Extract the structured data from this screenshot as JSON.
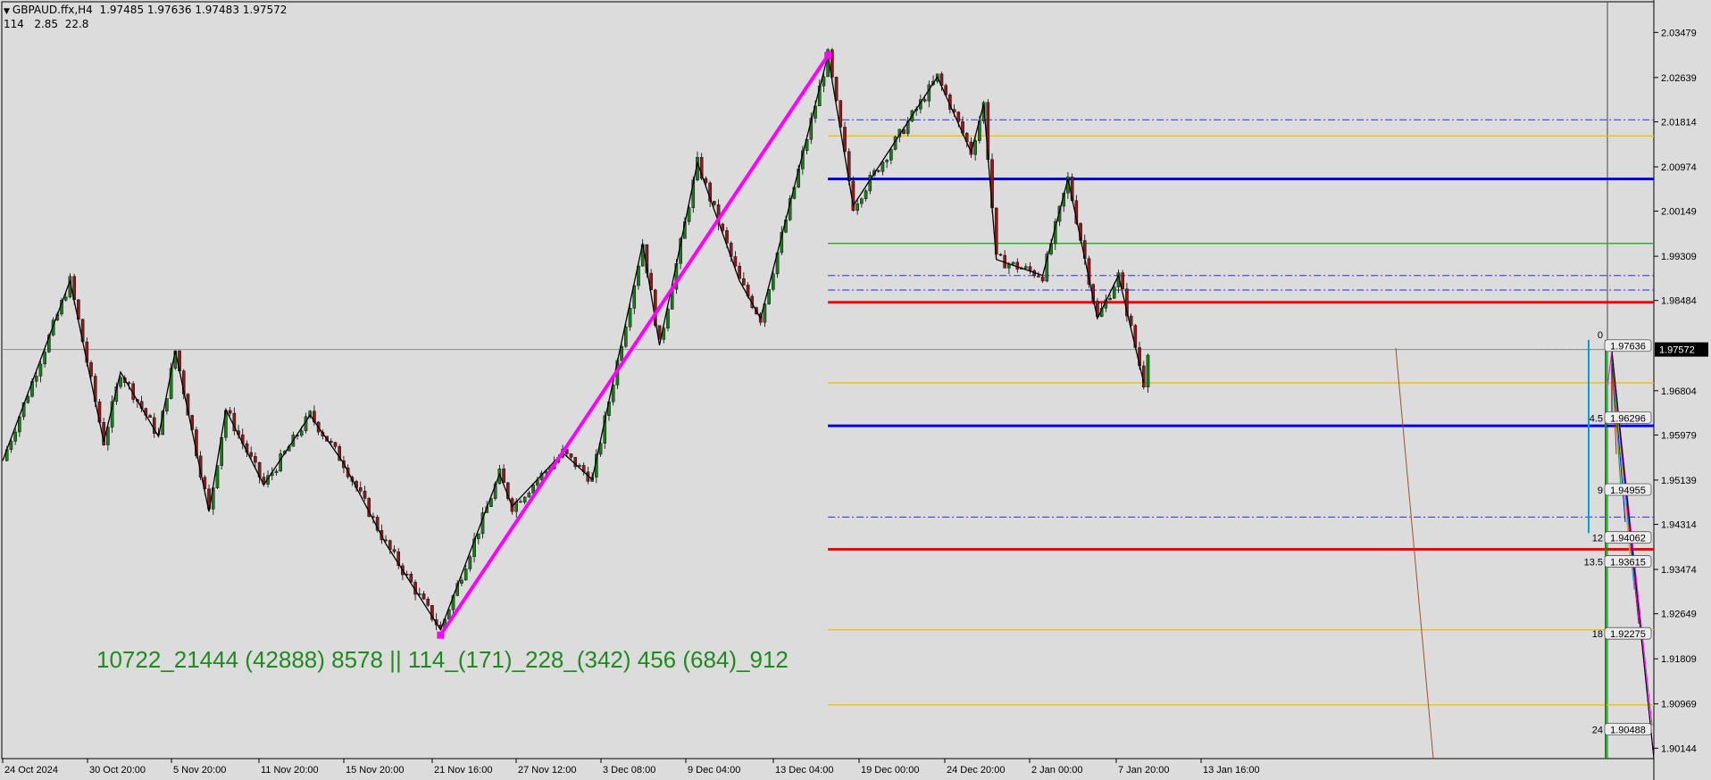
{
  "header": {
    "symbol": "GBPAUD.ffx,H4",
    "ohlc": "1.97485 1.97636 1.97483 1.97572",
    "indicator": "114   2.85  22.8"
  },
  "big_label": "10722_21444 (42888) 8578 || 114_(171)_228_(342) 456 (684)_912",
  "colors": {
    "background": "#dcdcdc",
    "zigzag": "#000000",
    "magenta_line": "#ff00ff",
    "blue": "#0000ee",
    "red": "#ff0000",
    "yellow": "#f2c200",
    "green": "#1fb01f",
    "dashdot": "#2a2ae0",
    "big_label": "#1f8b1f",
    "bull_candle": "#1a7a1a",
    "bear_candle": "#8b1a1a"
  },
  "chart_data": {
    "type": "line",
    "timeframe": "H4",
    "current_price": "1.97572",
    "x_tick_labels": [
      "24 Oct 2024",
      "30 Oct 20:00",
      "5 Nov 20:00",
      "11 Nov 20:00",
      "15 Nov 20:00",
      "21 Nov 16:00",
      "27 Nov 12:00",
      "3 Dec 08:00",
      "9 Dec 04:00",
      "13 Dec 04:00",
      "19 Dec 00:00",
      "24 Dec 20:00",
      "2 Jan 00:00",
      "7 Jan 20:00",
      "13 Jan 16:00"
    ],
    "y_ticks": [
      2.03479,
      2.02639,
      2.01814,
      2.00974,
      2.00149,
      1.99309,
      1.98484,
      1.96804,
      1.95979,
      1.95139,
      1.94314,
      1.93474,
      1.92649,
      1.91809,
      1.90969,
      1.90144
    ],
    "y_tick_labels": [
      "2.03479",
      "2.02639",
      "2.01814",
      "2.00974",
      "2.00149",
      "1.99309",
      "1.98484",
      "1.96804",
      "1.95979",
      "1.95139",
      "1.94314",
      "1.93474",
      "1.92649",
      "1.91809",
      "1.90969",
      "1.90144"
    ],
    "ylim": [
      1.8995,
      2.0405
    ],
    "zigzag": [
      {
        "x": 0,
        "y": 1.955
      },
      {
        "x": 8,
        "y": 1.9885
      },
      {
        "x": 12,
        "y": 1.9585
      },
      {
        "x": 14,
        "y": 1.9715
      },
      {
        "x": 18.5,
        "y": 1.9595
      },
      {
        "x": 20.5,
        "y": 1.9755
      },
      {
        "x": 24.5,
        "y": 1.9455
      },
      {
        "x": 26.5,
        "y": 1.9645
      },
      {
        "x": 31,
        "y": 1.9505
      },
      {
        "x": 36.5,
        "y": 1.9635
      },
      {
        "x": 40.5,
        "y": 1.9545
      },
      {
        "x": 45.5,
        "y": 1.9395
      },
      {
        "x": 52,
        "y": 1.9235
      },
      {
        "x": 59,
        "y": 1.9525
      },
      {
        "x": 60.5,
        "y": 1.9465
      },
      {
        "x": 66.5,
        "y": 1.9565
      },
      {
        "x": 70,
        "y": 1.9515
      },
      {
        "x": 76,
        "y": 1.9955
      },
      {
        "x": 78,
        "y": 1.9765
      },
      {
        "x": 82.5,
        "y": 2.0105
      },
      {
        "x": 87.5,
        "y": 1.9885
      },
      {
        "x": 90,
        "y": 1.9815
      },
      {
        "x": 98,
        "y": 2.0305
      },
      {
        "x": 101,
        "y": 2.0025
      },
      {
        "x": 111,
        "y": 2.0265
      },
      {
        "x": 115,
        "y": 2.0125
      },
      {
        "x": 116.5,
        "y": 2.0215
      },
      {
        "x": 118,
        "y": 1.9925
      },
      {
        "x": 123.5,
        "y": 1.9895
      },
      {
        "x": 126.5,
        "y": 2.0075
      },
      {
        "x": 130,
        "y": 1.9815
      },
      {
        "x": 132.5,
        "y": 1.9895
      },
      {
        "x": 135.5,
        "y": 1.9695
      }
    ],
    "extra_price": {
      "x": 136,
      "y": 1.97572
    },
    "magenta_trendline": [
      {
        "x": 52,
        "y": 1.9225
      },
      {
        "x": 98,
        "y": 2.0305
      }
    ],
    "horizontal_levels": [
      {
        "price": 2.0185,
        "color": "dashdot",
        "style": "dashdot"
      },
      {
        "price": 2.0155,
        "color": "yellow",
        "style": "solid"
      },
      {
        "price": 2.0075,
        "color": "blue",
        "style": "thick"
      },
      {
        "price": 1.9955,
        "color": "green",
        "style": "solid"
      },
      {
        "price": 1.9895,
        "color": "dashdot",
        "style": "dashdot"
      },
      {
        "price": 1.9868,
        "color": "dashdot",
        "style": "dashdot"
      },
      {
        "price": 1.9845,
        "color": "red",
        "style": "thick"
      },
      {
        "price": 1.9695,
        "color": "yellow",
        "style": "solid"
      },
      {
        "price": 1.9615,
        "color": "blue",
        "style": "thick"
      },
      {
        "price": 1.9445,
        "color": "dashdot",
        "style": "dashdot"
      },
      {
        "price": 1.9385,
        "color": "red",
        "style": "thick"
      },
      {
        "price": 1.9235,
        "color": "yellow",
        "style": "solid"
      },
      {
        "price": 1.9095,
        "color": "yellow",
        "style": "solid"
      }
    ],
    "level_tags": [
      {
        "label": "0",
        "value": "",
        "price": 1.9785
      },
      {
        "label": "",
        "value": "1.97636",
        "price": 1.97636
      },
      {
        "label": "4.5",
        "value": "1.96296",
        "price": 1.96296
      },
      {
        "label": "9",
        "value": "1.94955",
        "price": 1.94955
      },
      {
        "label": "12",
        "value": "1.94062",
        "price": 1.94062
      },
      {
        "label": "13.5",
        "value": "1.93615",
        "price": 1.93615
      },
      {
        "label": "18",
        "value": "1.92275",
        "price": 1.92275
      },
      {
        "label": "24",
        "value": "1.90488",
        "price": 1.90488
      }
    ],
    "grid": false
  }
}
